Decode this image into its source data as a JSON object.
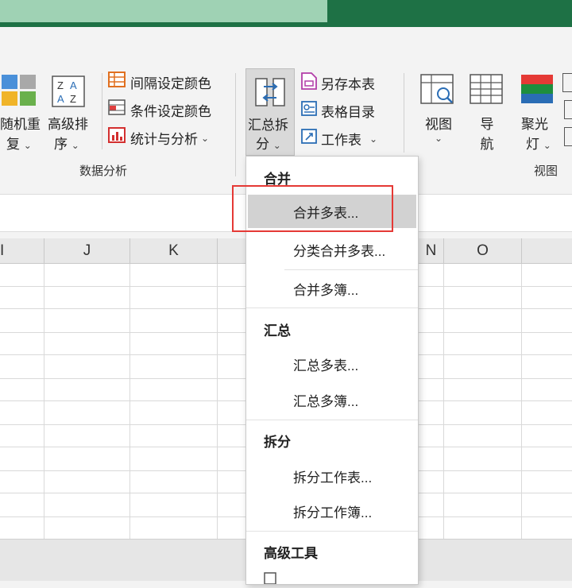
{
  "ribbon": {
    "random_dup": {
      "line1": "随机重",
      "line2": "复"
    },
    "adv_sort": {
      "line1": "高级排",
      "line2": "序"
    },
    "interval_color": "间隔设定颜色",
    "cond_color": "条件设定颜色",
    "stats": "统计与分析",
    "group_data_label": "数据分析",
    "summarize_split": {
      "line1": "汇总拆",
      "line2": "分"
    },
    "save_as_table": "另存本表",
    "table_dir": "表格目录",
    "worksheet": "工作表",
    "view": "视图",
    "nav": {
      "line1": "导",
      "line2": "航"
    },
    "spotlight": {
      "line1": "聚光",
      "line2": "灯"
    },
    "group_view_label": "视图"
  },
  "columns": [
    "I",
    "J",
    "K",
    "N",
    "O"
  ],
  "menu": {
    "sections": [
      {
        "title": "合并",
        "items": [
          "合并多表...",
          "分类合并多表...",
          "合并多簿..."
        ]
      },
      {
        "title": "汇总",
        "items": [
          "汇总多表...",
          "汇总多簿..."
        ]
      },
      {
        "title": "拆分",
        "items": [
          "拆分工作表...",
          "拆分工作簿..."
        ]
      },
      {
        "title": "高级工具",
        "items": []
      }
    ],
    "highlighted": "合并多表..."
  },
  "colors": {
    "brand": "#1e7145",
    "highlight_box": "#e53935"
  }
}
